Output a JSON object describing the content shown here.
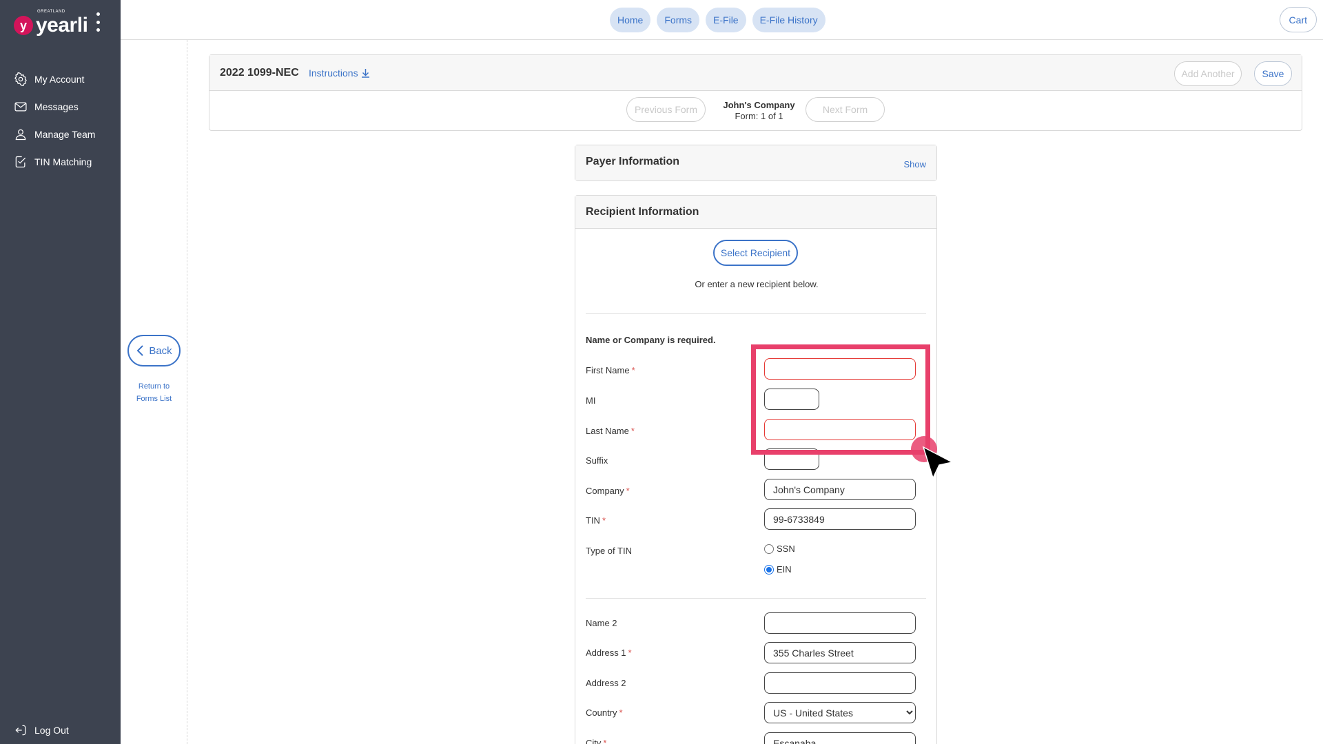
{
  "app": {
    "logo_small": "GREATLAND",
    "logo_text": "yearli",
    "logo_badge": "y"
  },
  "sidebar": {
    "items": [
      {
        "label": "My Account",
        "icon": "gear-icon"
      },
      {
        "label": "Messages",
        "icon": "envelope-icon"
      },
      {
        "label": "Manage Team",
        "icon": "user-icon"
      },
      {
        "label": "TIN Matching",
        "icon": "checklist-icon"
      }
    ],
    "logout_label": "Log Out"
  },
  "topnav": {
    "items": [
      "Home",
      "Forms",
      "E-File",
      "E-File History"
    ],
    "cart_label": "Cart"
  },
  "back": {
    "button_label": "Back",
    "return_line1": "Return to",
    "return_line2": "Forms List"
  },
  "form": {
    "title": "2022 1099-NEC",
    "instructions_label": "Instructions",
    "add_another_label": "Add Another",
    "save_label": "Save",
    "previous_label": "Previous Form",
    "next_label": "Next Form",
    "company_name": "John's Company",
    "form_counter": "Form: 1 of 1"
  },
  "payer": {
    "title": "Payer Information",
    "show_label": "Show"
  },
  "recipient": {
    "title": "Recipient Information",
    "select_label": "Select Recipient",
    "or_text": "Or enter a new recipient below.",
    "required_note": "Name or Company is required.",
    "fields": {
      "first_name": {
        "label": "First Name",
        "value": ""
      },
      "mi": {
        "label": "MI",
        "value": ""
      },
      "last_name": {
        "label": "Last Name",
        "value": ""
      },
      "suffix": {
        "label": "Suffix",
        "value": ""
      },
      "company": {
        "label": "Company",
        "value": "John's Company"
      },
      "tin": {
        "label": "TIN",
        "value": "99-6733849"
      },
      "tin_type": {
        "label": "Type of TIN",
        "options": [
          "SSN",
          "EIN"
        ],
        "selected": "EIN"
      },
      "name2": {
        "label": "Name 2",
        "value": ""
      },
      "address1": {
        "label": "Address 1",
        "value": "355 Charles Street"
      },
      "address2": {
        "label": "Address 2",
        "value": ""
      },
      "country": {
        "label": "Country",
        "value": "US - United States"
      },
      "city": {
        "label": "City",
        "value": "Escanaba"
      }
    },
    "required_marker": "*"
  },
  "colors": {
    "sidebar_bg": "#3d4350",
    "accent": "#3b73c8",
    "pill_bg": "#d7e3f4",
    "highlight": "#e8406b",
    "invalid": "#e53935"
  }
}
